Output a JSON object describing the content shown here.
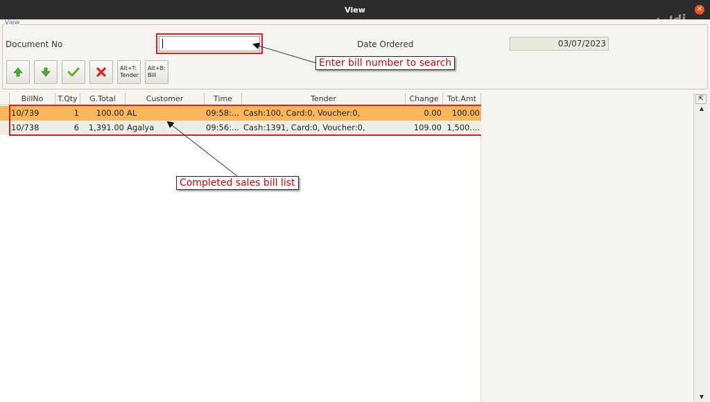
{
  "window": {
    "title": "View"
  },
  "watermark": "Jaldi",
  "panel": {
    "group_label": "View"
  },
  "form": {
    "document_no_label": "Document No",
    "document_no_value": "",
    "date_ordered_label": "Date Ordered",
    "date_ordered_value": "03/07/2023"
  },
  "toolbar": {
    "tender_button": {
      "line1": "Alt+T:",
      "line2": "Tender"
    },
    "bill_button": {
      "line1": "Alt+B:",
      "line2": "Bill"
    }
  },
  "callouts": {
    "search": "Enter bill number to search",
    "list": "Completed sales bill list"
  },
  "table": {
    "columns": [
      "BillNo",
      "T.Qty",
      "G.Total",
      "Customer",
      "Time",
      "Tender",
      "Change",
      "Tot.Amt"
    ],
    "rows": [
      {
        "bill_no": "10/739",
        "tqty": "1",
        "gtotal": "100.00",
        "customer": "AL",
        "time": "09:58:...",
        "tender": "Cash:100, Card:0, Voucher:0,",
        "change": "0.00",
        "totamt": "100.00"
      },
      {
        "bill_no": "10/738",
        "tqty": "6",
        "gtotal": "1,391.00",
        "customer": "Agalya",
        "time": "09:56:...",
        "tender": "Cash:1391, Card:0, Voucher:0,",
        "change": "109.00",
        "totamt": "1,500...."
      }
    ]
  },
  "colors": {
    "selected_row": "#f6b65a",
    "annotation_red": "#e02020",
    "title_bar": "#2c2c2c"
  },
  "icons": [
    "arrow-up-icon",
    "arrow-down-icon",
    "checkmark-icon",
    "cross-icon",
    "table-corner-icon",
    "scroll-up-icon",
    "scroll-down-icon",
    "close-icon"
  ]
}
